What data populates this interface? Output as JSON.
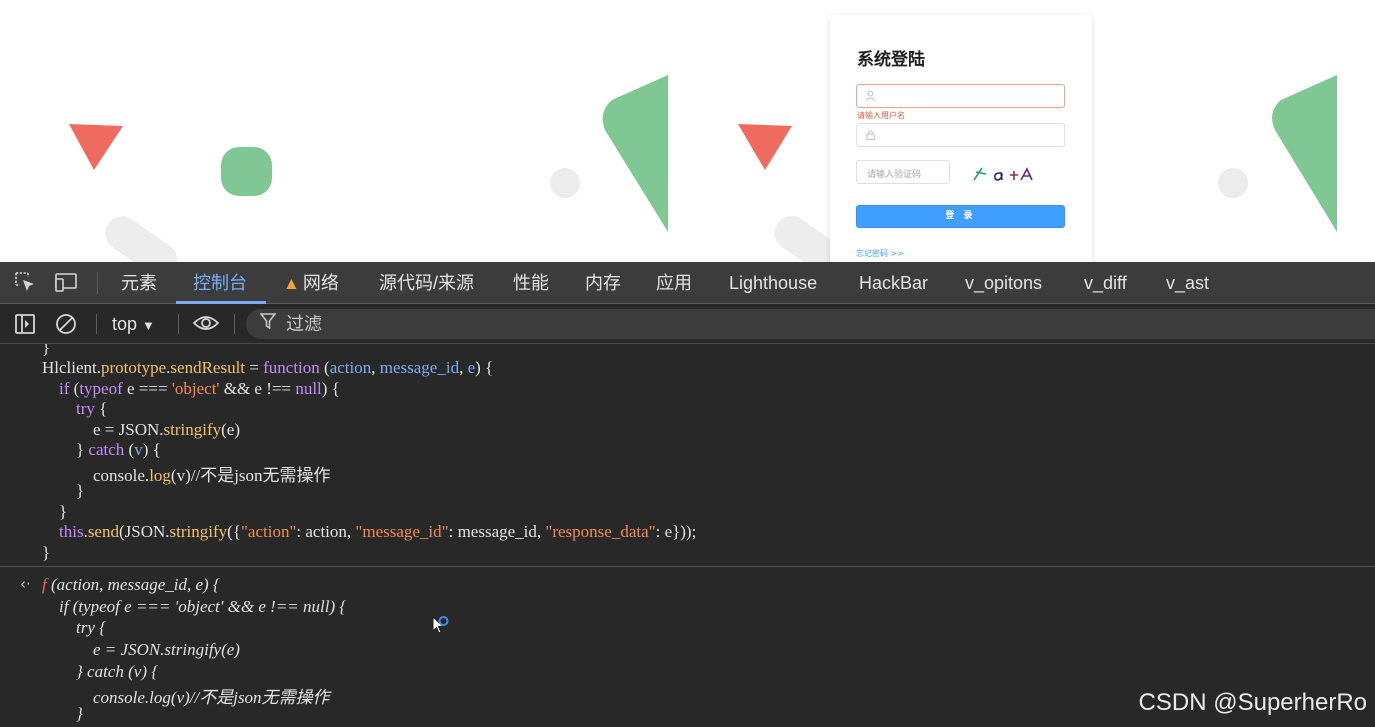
{
  "login": {
    "title": "系统登陆",
    "username_error": "请输入用户名",
    "captcha_placeholder": "请输入验证码",
    "captcha_text": "1 a +A",
    "login_button": "登 录",
    "forgot_link": "忘记密码 >>"
  },
  "devtools": {
    "tabs": [
      "元素",
      "控制台",
      "网络",
      "源代码/来源",
      "性能",
      "内存",
      "应用",
      "Lighthouse",
      "HackBar",
      "v_opitons",
      "v_diff",
      "v_ast"
    ],
    "active_tab": "控制台",
    "context": "top",
    "filter_label": "过滤"
  },
  "console": {
    "input_lines": [
      "}",
      "Hlclient.prototype.sendResult = function (action, message_id, e) {",
      "    if (typeof e === 'object' && e !== null) {",
      "        try {",
      "            e = JSON.stringify(e)",
      "        } catch (v) {",
      "            console.log(v)//不是json无需操作",
      "        }",
      "    }",
      "    this.send(JSON.stringify({\"action\": action, \"message_id\": message_id, \"response_data\": e}));",
      "}"
    ],
    "output_lines": [
      "f (action, message_id, e) {",
      "    if (typeof e === 'object' && e !== null) {",
      "        try {",
      "            e = JSON.stringify(e)",
      "        } catch (v) {",
      "            console.log(v)//不是json无需操作",
      "        }"
    ]
  },
  "watermark": "CSDN @SuperherRo",
  "colors": {
    "shape_red": "#ef6b5f",
    "shape_green": "#7fc893",
    "shape_grey": "#ececec",
    "accent_blue": "#7cacf8",
    "button_blue": "#409eff"
  }
}
